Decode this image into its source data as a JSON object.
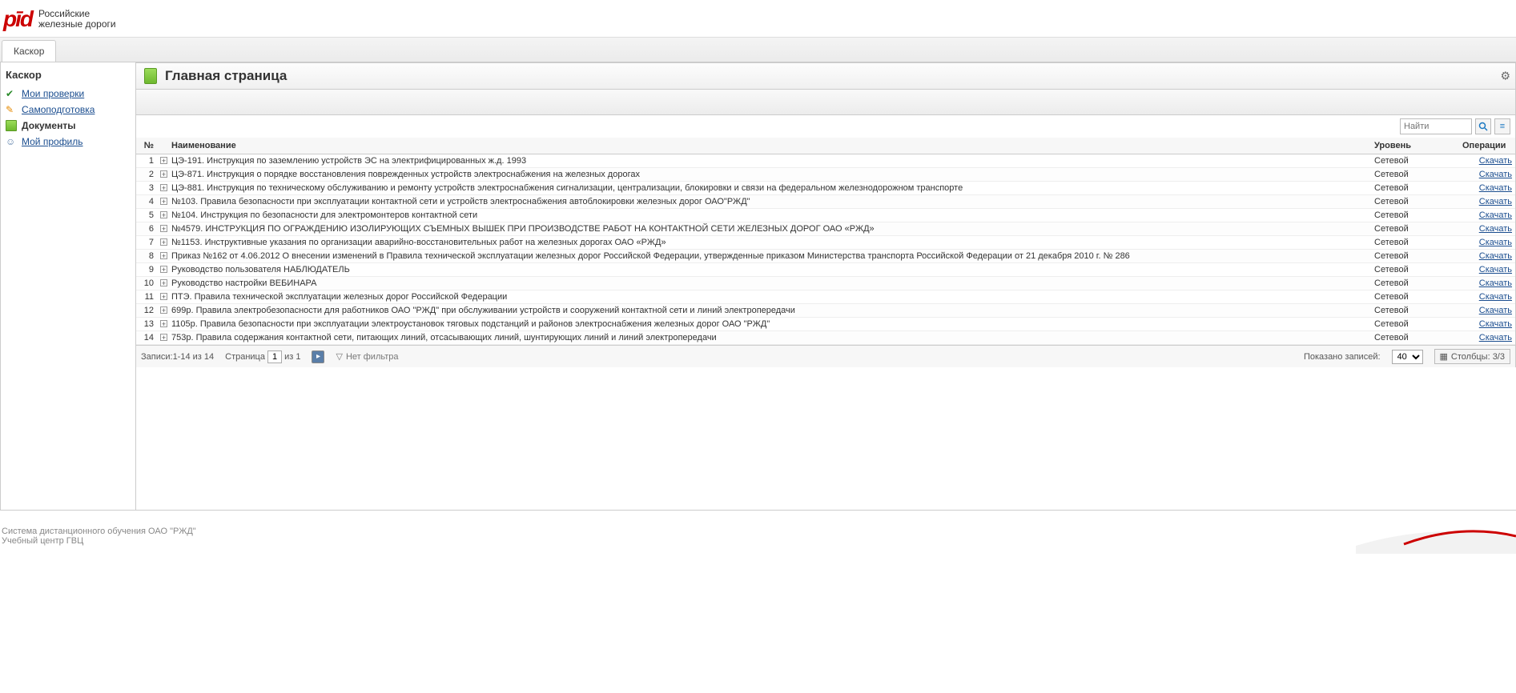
{
  "brand": {
    "mark": "pīd",
    "line1": "Российские",
    "line2": "железные дороги"
  },
  "tab": "Каскор",
  "sidebar": {
    "title": "Каскор",
    "items": [
      {
        "label": "Мои проверки"
      },
      {
        "label": "Самоподготовка"
      },
      {
        "label": "Документы"
      },
      {
        "label": "Мой профиль"
      }
    ]
  },
  "page": {
    "title": "Главная страница"
  },
  "search": {
    "placeholder": "Найти"
  },
  "columns": {
    "num": "№",
    "name": "Наименование",
    "level": "Уровень",
    "ops": "Операции"
  },
  "rows": [
    {
      "n": "1",
      "name": "ЦЭ-191. Инструкция по заземлению устройств ЭС на электрифицированных ж.д. 1993",
      "level": "Сетевой",
      "op": "Скачать"
    },
    {
      "n": "2",
      "name": "ЦЭ-871. Инструкция о порядке восстановления поврежденных устройств электроснабжения на железных дорогах",
      "level": "Сетевой",
      "op": "Скачать"
    },
    {
      "n": "3",
      "name": "ЦЭ-881. Инструкция по техническому обслуживанию и ремонту устройств электроснабжения сигнализации, централизации, блокировки и связи на федеральном железнодорожном транспорте",
      "level": "Сетевой",
      "op": "Скачать"
    },
    {
      "n": "4",
      "name": "№103. Правила безопасности при эксплуатации контактной сети и устройств электроснабжения автоблокировки железных дорог ОАО\"РЖД\"",
      "level": "Сетевой",
      "op": "Скачать"
    },
    {
      "n": "5",
      "name": "№104. Инструкция по безопасности для электромонтеров контактной сети",
      "level": "Сетевой",
      "op": "Скачать"
    },
    {
      "n": "6",
      "name": "№4579. ИНСТРУКЦИЯ ПО ОГРАЖДЕНИЮ ИЗОЛИРУЮЩИХ СЪЕМНЫХ ВЫШЕК ПРИ ПРОИЗВОДСТВЕ РАБОТ НА КОНТАКТНОЙ СЕТИ ЖЕЛЕЗНЫХ ДОРОГ ОАО «РЖД»",
      "level": "Сетевой",
      "op": "Скачать"
    },
    {
      "n": "7",
      "name": "№1153. Инструктивные указания по организации аварийно-восстановительных работ на железных дорогах ОАО «РЖД»",
      "level": "Сетевой",
      "op": "Скачать"
    },
    {
      "n": "8",
      "name": "Приказ №162 от 4.06.2012 О внесении изменений в Правила технической эксплуатации железных дорог Российской Федерации, утвержденные приказом Министерства транспорта Российской Федерации от 21 декабря 2010 г. № 286",
      "level": "Сетевой",
      "op": "Скачать"
    },
    {
      "n": "9",
      "name": "Руководство пользователя НАБЛЮДАТЕЛЬ",
      "level": "Сетевой",
      "op": "Скачать"
    },
    {
      "n": "10",
      "name": "Руководство настройки ВЕБИНАРА",
      "level": "Сетевой",
      "op": "Скачать"
    },
    {
      "n": "11",
      "name": "ПТЭ. Правила технической эксплуатации железных дорог Российской Федерации",
      "level": "Сетевой",
      "op": "Скачать"
    },
    {
      "n": "12",
      "name": "699р. Правила электробезопасности для работников ОАО \"РЖД\" при обслуживании устройств и сооружений контактной сети и линий электропередачи",
      "level": "Сетевой",
      "op": "Скачать"
    },
    {
      "n": "13",
      "name": "1105р. Правила безопасности при эксплуатации электроустановок тяговых подстанций и районов электроснабжения железных дорог ОАО \"РЖД\"",
      "level": "Сетевой",
      "op": "Скачать"
    },
    {
      "n": "14",
      "name": "753р. Правила содержания контактной сети, питающих линий, отсасывающих линий, шунтирующих линий и линий электропередачи",
      "level": "Сетевой",
      "op": "Скачать"
    }
  ],
  "pager": {
    "records": "Записи:1-14 из 14",
    "page_label": "Страница",
    "page_value": "1",
    "page_of": "из 1",
    "nofilter": "Нет фильтра",
    "shown_label": "Показано записей:",
    "shown_value": "40",
    "columns_label": "Столбцы: 3/3"
  },
  "footer": {
    "line1": "Система дистанционного обучения ОАО \"РЖД\"",
    "line2": "Учебный центр ГВЦ"
  }
}
